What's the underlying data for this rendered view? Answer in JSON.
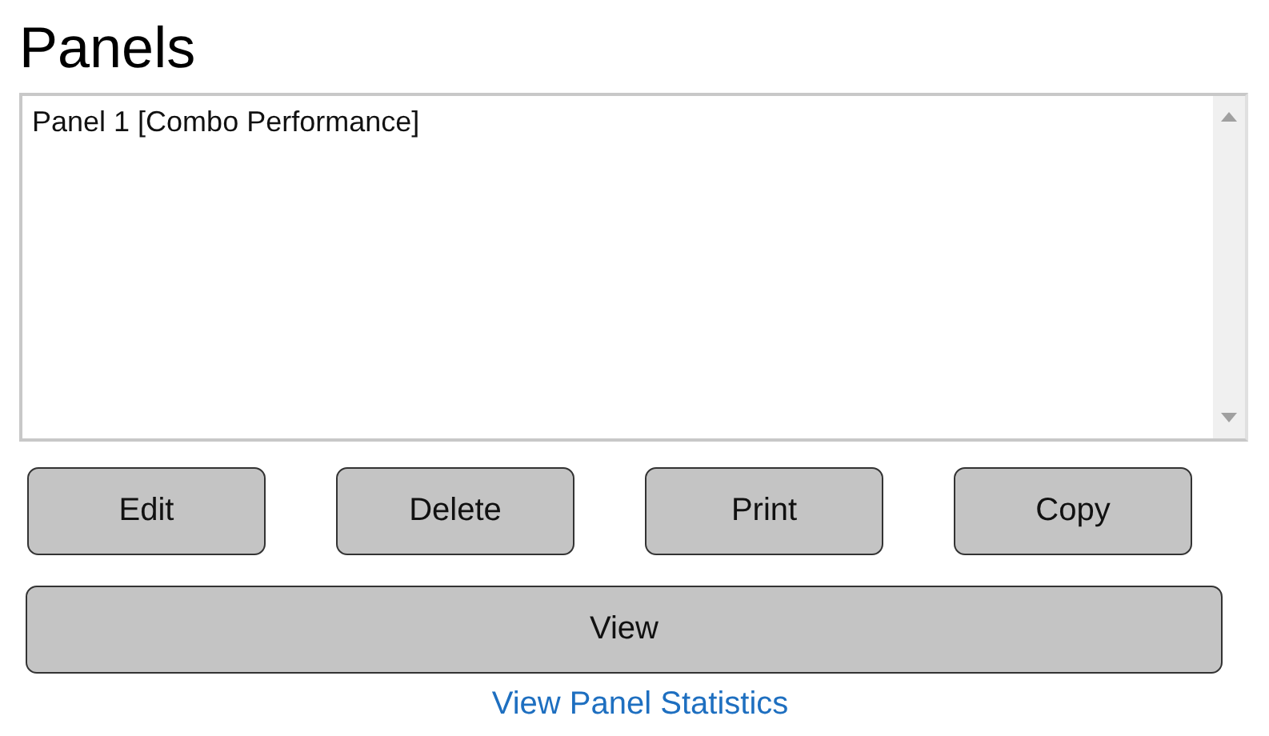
{
  "title": "Panels",
  "panels_list": {
    "items": [
      "Panel 1 [Combo Performance]"
    ]
  },
  "buttons": [
    "Edit",
    "Delete",
    "Print",
    "Copy"
  ],
  "view_button": "View",
  "statistics_link": "View Panel Statistics"
}
